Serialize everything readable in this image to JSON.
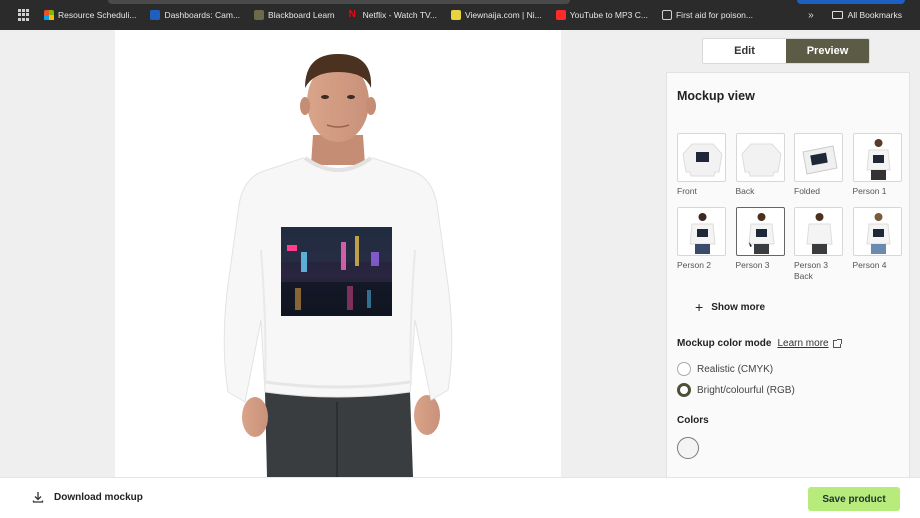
{
  "bookmarks": {
    "items": [
      {
        "label": "Resource Scheduli...",
        "icon": "microsoft-icon"
      },
      {
        "label": "Dashboards: Cam...",
        "icon": "dashboard-icon"
      },
      {
        "label": "Blackboard Learn",
        "icon": "blackboard-icon"
      },
      {
        "label": "Netflix - Watch TV...",
        "icon": "netflix-icon"
      },
      {
        "label": "Viewnaija.com | Ni...",
        "icon": "viewnaija-icon"
      },
      {
        "label": "YouTube to MP3 C...",
        "icon": "youtube-icon"
      },
      {
        "label": "First aid for poison...",
        "icon": "globe-icon"
      }
    ],
    "netflix_glyph": "N",
    "overflow_glyph": "»",
    "all_bookmarks": "All Bookmarks"
  },
  "toggle": {
    "edit": "Edit",
    "preview": "Preview",
    "active": "Preview"
  },
  "panel": {
    "title": "Mockup view",
    "thumbnails": [
      {
        "label": "Front",
        "kind": "flat-front"
      },
      {
        "label": "Back",
        "kind": "flat-back"
      },
      {
        "label": "Folded",
        "kind": "folded"
      },
      {
        "label": "Person 1",
        "kind": "person"
      },
      {
        "label": "Person 2",
        "kind": "person"
      },
      {
        "label": "Person 3",
        "kind": "person",
        "selected": true
      },
      {
        "label": "Person 3 Back",
        "kind": "person-back"
      },
      {
        "label": "Person 4",
        "kind": "person"
      }
    ],
    "show_more": "Show more",
    "color_mode_title": "Mockup color mode",
    "learn_more": "Learn more",
    "radio_realistic": "Realistic (CMYK)",
    "radio_bright": "Bright/colourful (RGB)",
    "selected_mode": "Bright/colourful (RGB)",
    "colors_title": "Colors",
    "swatch_color": "#f4f4f4"
  },
  "footer": {
    "download": "Download mockup",
    "save": "Save product"
  },
  "colors": {
    "accent_dark": "#5c5b45",
    "save_green": "#b7ec7c"
  }
}
